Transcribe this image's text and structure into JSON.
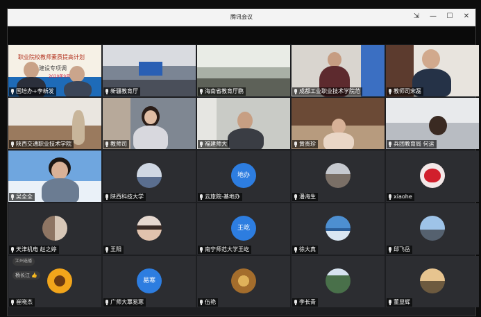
{
  "window": {
    "title": "腾讯会议",
    "controls": [
      "pin-icon",
      "minimize-icon",
      "maximize-icon",
      "close-icon"
    ]
  },
  "banner": {
    "title": "职业院校教师素质提高计划",
    "subtitle": "建设专项调",
    "date": "2020年9月28日"
  },
  "participants": [
    {
      "name": "国培办+李新发",
      "type": "video"
    },
    {
      "name": "新疆教育厅",
      "type": "video"
    },
    {
      "name": "海南省教育厅鹏",
      "type": "video"
    },
    {
      "name": "成都工业职业技术学院范",
      "type": "video"
    },
    {
      "name": "教师司宋磊",
      "type": "video"
    },
    {
      "name": "陕西交通职业技术学院",
      "type": "video"
    },
    {
      "name": "教师司",
      "type": "video"
    },
    {
      "name": "福建师大",
      "type": "video"
    },
    {
      "name": "黄贵珍",
      "type": "video"
    },
    {
      "name": "兵团教育局 何运",
      "type": "video"
    },
    {
      "name": "吴全全",
      "type": "video"
    },
    {
      "name": "陕西科技大学",
      "type": "avatar-photo"
    },
    {
      "name": "云旅院-基地办",
      "type": "avatar-text",
      "avatar_text": "地办"
    },
    {
      "name": "潘海生",
      "type": "avatar-photo"
    },
    {
      "name": "xiaohe",
      "type": "avatar-photo"
    },
    {
      "name": "天津机电 赵之婷",
      "type": "avatar-photo"
    },
    {
      "name": "王阳",
      "type": "avatar-photo"
    },
    {
      "name": "南宁师范大学王屹",
      "type": "avatar-text",
      "avatar_text": "王屹"
    },
    {
      "name": "徐大真",
      "type": "avatar-photo"
    },
    {
      "name": "邱飞岳",
      "type": "avatar-photo"
    },
    {
      "name": "崔晓杰",
      "type": "avatar-photo"
    },
    {
      "name": "广师大覃易寒",
      "type": "avatar-text",
      "avatar_text": "易寒"
    },
    {
      "name": "伍艳",
      "type": "avatar-photo"
    },
    {
      "name": "李长青",
      "type": "avatar-photo"
    },
    {
      "name": "董显辉",
      "type": "avatar-photo"
    }
  ],
  "overlays": {
    "tip1": "江州选播",
    "tip2": "杨长江 👍"
  },
  "colors": {
    "avatar_blue": "#2d7de0",
    "tile_bg": "#2c2d31",
    "window_bg": "#1d1e21"
  }
}
